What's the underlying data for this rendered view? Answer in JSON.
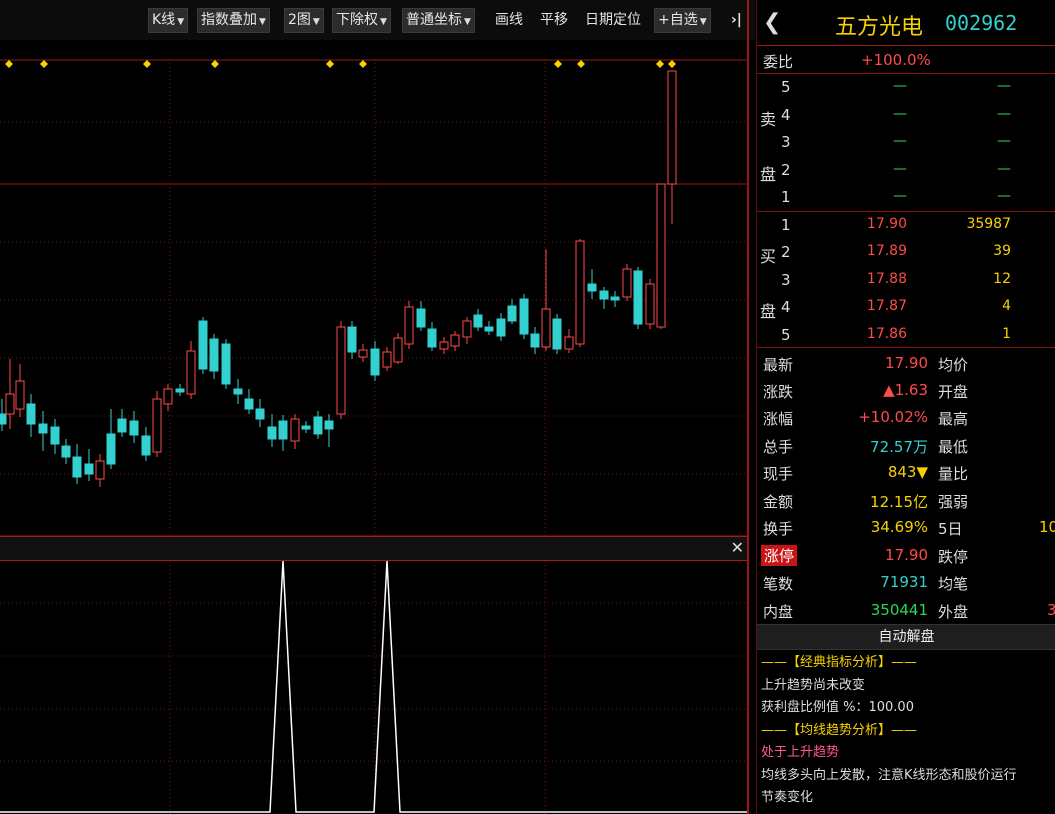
{
  "toolbar": {
    "kline_label": "K线",
    "index_overlay_label": "指数叠加",
    "two_chart_label": "2图",
    "adjust_label": "下除权",
    "coord_label": "普通坐标",
    "draw_label": "画线",
    "pan_label": "平移",
    "date_locate_label": "日期定位",
    "watchlist_label": "+自选",
    "collapse_label": "›|"
  },
  "quote": {
    "name": "五方光电",
    "code": "002962",
    "commission_ratio_label": "委比",
    "commission_ratio": "+100.0%",
    "sell_side_chars": [
      "卖",
      "盘"
    ],
    "buy_side_chars": [
      "买",
      "盘"
    ],
    "sell_levels": [
      {
        "level": "5",
        "price": "—",
        "volume": "—"
      },
      {
        "level": "4",
        "price": "—",
        "volume": "—"
      },
      {
        "level": "3",
        "price": "—",
        "volume": "—"
      },
      {
        "level": "2",
        "price": "—",
        "volume": "—"
      },
      {
        "level": "1",
        "price": "—",
        "volume": "—"
      }
    ],
    "buy_levels": [
      {
        "level": "1",
        "price": "17.90",
        "volume": "35987"
      },
      {
        "level": "2",
        "price": "17.89",
        "volume": "39"
      },
      {
        "level": "3",
        "price": "17.88",
        "volume": "12"
      },
      {
        "level": "4",
        "price": "17.87",
        "volume": "4"
      },
      {
        "level": "5",
        "price": "17.86",
        "volume": "1"
      }
    ],
    "stats": [
      {
        "label": "最新",
        "value": "17.90",
        "label2": "均价",
        "value2": ""
      },
      {
        "label": "涨跌",
        "value": "▲1.63",
        "label2": "开盘",
        "value2": ""
      },
      {
        "label": "涨幅",
        "value": "+10.02%",
        "label2": "最高",
        "value2": ""
      },
      {
        "label": "总手",
        "value": "72.57万",
        "label2": "最低",
        "value2": ""
      },
      {
        "label": "现手",
        "value": "843▼",
        "label2": "量比",
        "value2": ""
      },
      {
        "label": "金额",
        "value": "12.15亿",
        "label2": "强弱",
        "value2": ""
      },
      {
        "label": "换手",
        "value": "34.69%",
        "label2": "5日",
        "value2": "10"
      },
      {
        "label": "涨停",
        "value": "17.90",
        "label2": "跌停",
        "value2": ""
      },
      {
        "label": "笔数",
        "value": "71931",
        "label2": "均笔",
        "value2": ""
      },
      {
        "label": "内盘",
        "value": "350441",
        "label2": "外盘",
        "value2": "3"
      }
    ],
    "auto_analysis_label": "自动解盘",
    "analysis_lines": [
      "——【经典指标分析】——",
      "上升趋势尚未改变",
      "获利盘比例值 %：100.00",
      "——【均线趋势分析】——",
      "处于上升趋势",
      "均线多头向上发散，注意K线形态和股价运行",
      "节奏变化"
    ]
  },
  "colors": {
    "up": "#ff4a4a",
    "down": "#33d0d0",
    "marker": "#f5d200",
    "grid": "#7a1010",
    "border": "#a01414"
  }
}
